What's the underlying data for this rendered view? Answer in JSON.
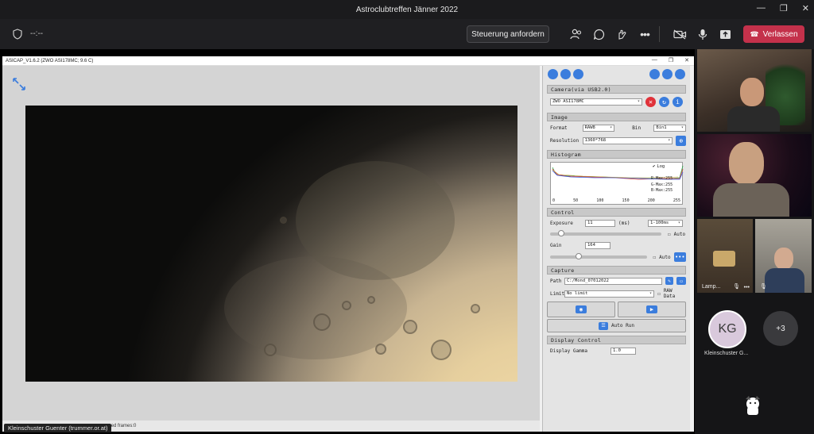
{
  "window": {
    "title": "Astroclubtreffen Jänner 2022"
  },
  "meeting": {
    "timer": "--:--",
    "request_control": "Steuerung anfordern",
    "leave": "Verlassen",
    "toolbar_icons": [
      "people-icon",
      "chat-icon",
      "reactions-icon",
      "more-icon",
      "camera-off-icon",
      "mic-icon",
      "share-icon"
    ]
  },
  "asicap": {
    "title": "ASICAP_V1.6.2 (ZWO ASI178MC; 9.6 C)",
    "status_text": "pped frames:0",
    "presenter_caption": "Kleinschuster Guenter (trummer.or.at)",
    "camera": {
      "header": "Camera(via USB2.0)",
      "device": "ZWO ASI178MC"
    },
    "image": {
      "header": "Image",
      "format_label": "Format",
      "format_value": "RAW8",
      "bin_label": "Bin",
      "bin_value": "Bin1",
      "resolution_label": "Resolution",
      "resolution_value": "1360*768"
    },
    "histogram": {
      "header": "Histogram",
      "log_label": "Log",
      "r_max": "R-Max:255",
      "g_max": "G-Max:255",
      "b_max": "B-Max:255",
      "ticks": [
        "0",
        "50",
        "100",
        "150",
        "200",
        "255"
      ]
    },
    "control": {
      "header": "Control",
      "exposure_label": "Exposure",
      "exposure_value": "11",
      "exposure_unit": "(ms)",
      "exposure_range": "1-100ms",
      "auto_label": "Auto",
      "gain_label": "Gain",
      "gain_value": "164",
      "exposure_slider": 0.1,
      "gain_slider": 0.3
    },
    "capture": {
      "header": "Capture",
      "path_label": "Path",
      "path_value": "C:/Mond_07012022",
      "limit_label": "Limit",
      "limit_value": "No limit",
      "raw_data_label": "RAW Data",
      "auto_run": "Auto Run"
    },
    "display": {
      "header": "Display Control",
      "gamma_label": "Display Gamma",
      "gamma_value": "1.0"
    }
  },
  "participants": {
    "tile3_label": "Lamp...",
    "kg_initials": "KG",
    "kg_name": "Kleinschuster G...",
    "more_count": "+3"
  },
  "colors": {
    "leave": "#c4314b",
    "accent_blue": "#3b7ddd",
    "red_button": "#e0323a"
  }
}
